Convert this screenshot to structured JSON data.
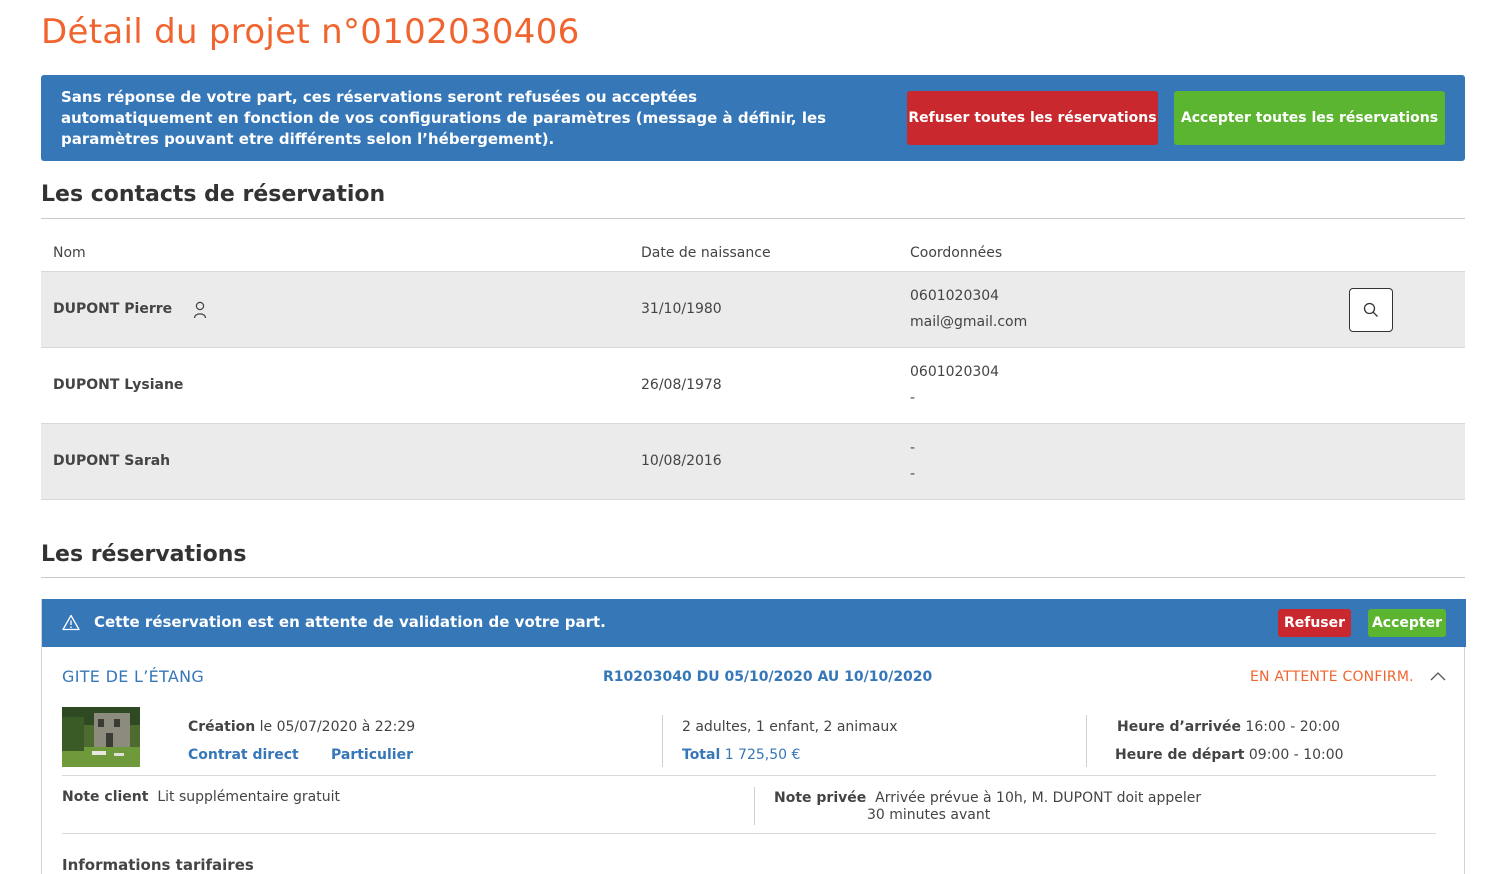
{
  "page": {
    "title": "Détail du projet n°0102030406"
  },
  "banner": {
    "message": "Sans réponse de votre part, ces réservations seront refusées ou acceptées automatiquement en fonction de vos configurations de paramètres (message à définir, les paramètres pouvant etre différents selon l’hébergement).",
    "refuse_all_label": "Refuser toutes les réservations",
    "accept_all_label": "Accepter toutes les réservations"
  },
  "contacts": {
    "title": "Les contacts de réservation",
    "headers": {
      "name": "Nom",
      "birth": "Date de naissance",
      "coords": "Coordonnées"
    },
    "rows": [
      {
        "name": "DUPONT Pierre",
        "birth": "31/10/1980",
        "phone": "0601020304",
        "email": "mail@gmail.com"
      },
      {
        "name": "DUPONT Lysiane",
        "birth": "26/08/1978",
        "phone": "0601020304",
        "email": "-"
      },
      {
        "name": "DUPONT Sarah",
        "birth": "10/08/2016",
        "phone": "-",
        "email": "-"
      }
    ]
  },
  "reservations": {
    "title": "Les réservations",
    "items": [
      {
        "alert": "Cette réservation est en attente de validation de votre part.",
        "refuse_label": "Refuser",
        "accept_label": "Accepter",
        "lodging": "GITE DE L’ÉTANG",
        "reference": "R10203040 DU 05/10/2020 AU 10/10/2020",
        "status": "EN ATTENTE CONFIRM.",
        "creation_label": "Création",
        "creation_value": "le 05/07/2020 à 22:29",
        "contract": "Contrat direct",
        "client_type": "Particulier",
        "guests": "2 adultes, 1 enfant, 2 animaux",
        "total_label": "Total",
        "total_value": "1 725,50 €",
        "arrival_label": "Heure d’arrivée",
        "arrival_value": "16:00 - 20:00",
        "departure_label": "Heure de départ",
        "departure_value": "09:00 - 10:00",
        "client_note_label": "Note client",
        "client_note": "Lit supplémentaire gratuit",
        "private_note_label": "Note privée",
        "private_note_line1": "Arrivée prévue à 10h, M. DUPONT doit appeler",
        "private_note_line2": "30 minutes avant",
        "pricing_title": "Informations tarifaires"
      }
    ]
  },
  "colors": {
    "accent_orange": "#f0652f",
    "banner_blue": "#3677b8",
    "refuse_red": "#c8282e",
    "accept_green": "#5cb531",
    "row_grey": "#ebebeb"
  },
  "icons": [
    "user-icon",
    "search-icon",
    "warning-icon",
    "chevron-up-icon"
  ]
}
